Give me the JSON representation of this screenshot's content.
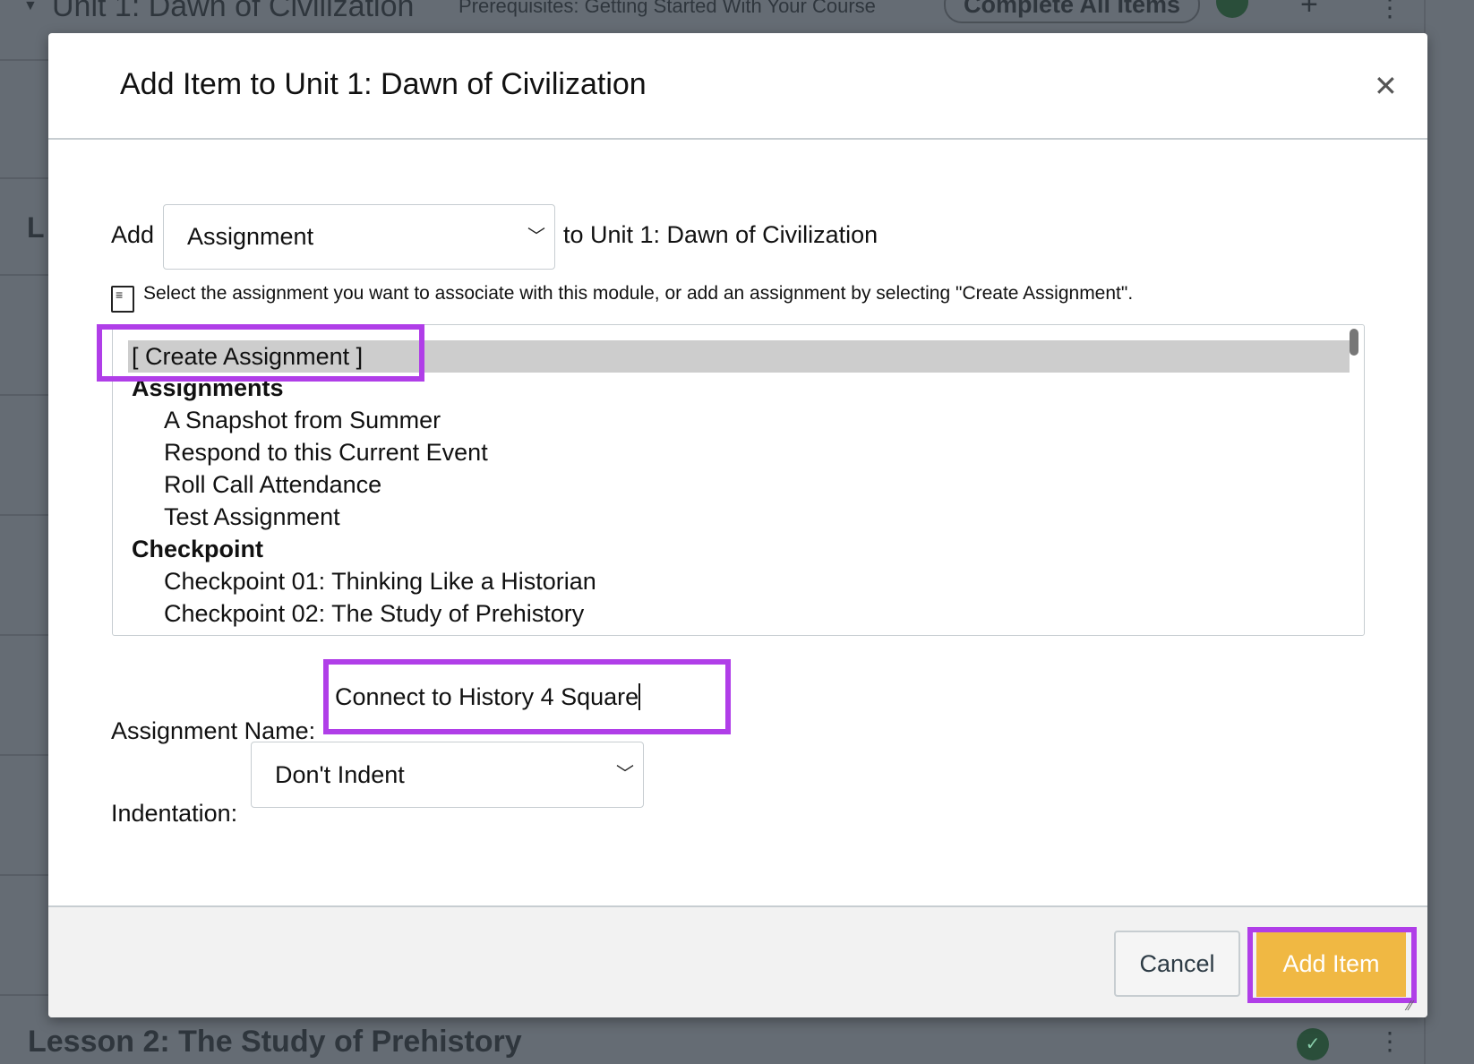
{
  "background": {
    "module_title": "Unit 1: Dawn of Civilization",
    "prerequisites": "Prerequisites: Getting Started With Your Course",
    "requirement_button": "Complete All Items",
    "partial_letter": "L",
    "next_module_title": "Lesson 2: The Study of Prehistory"
  },
  "modal": {
    "title": "Add Item to Unit 1: Dawn of Civilization",
    "close_icon": "close-icon",
    "add_label": "Add",
    "item_type": "Assignment",
    "to_label": "to Unit 1: Dawn of Civilization",
    "info_icon": "assignment-icon",
    "info_text": "Select the assignment you want to associate with this module, or add an assignment by selecting \"Create Assignment\".",
    "list": {
      "selected": "[ Create Assignment ]",
      "groups": [
        {
          "name": "Assignments",
          "items": [
            "A Snapshot from Summer",
            "Respond to this Current Event",
            "Roll Call Attendance",
            "Test Assignment"
          ]
        },
        {
          "name": "Checkpoint",
          "items": [
            "Checkpoint 01: Thinking Like a Historian",
            "Checkpoint 02: The Study of Prehistory"
          ]
        }
      ]
    },
    "assignment_name_label": "Assignment Name:",
    "assignment_name_value": "Connect to History 4 Square",
    "indentation_label": "Indentation:",
    "indentation_value": "Don't Indent",
    "cancel_label": "Cancel",
    "add_item_label": "Add Item",
    "colors": {
      "highlight": "#b03ee8",
      "primary_button": "#f0b843"
    }
  }
}
